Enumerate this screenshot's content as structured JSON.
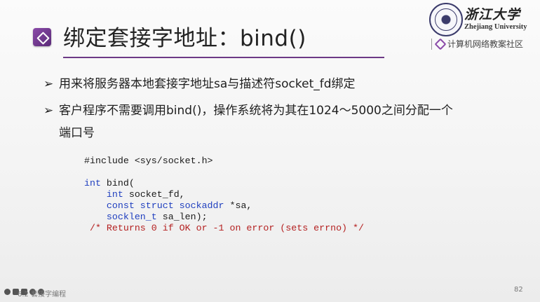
{
  "slide": {
    "title": "绑定套接字地址：bind()",
    "logo": {
      "university_cn": "浙江大学",
      "university_en": "Zhejiang University",
      "community": "计算机网络教案社区"
    },
    "bullets": [
      "用来将服务器本地套接字地址sa与描述符socket_fd绑定",
      "客户程序不需要调用bind()，操作系统将为其在1024～5000之间分配一个"
    ],
    "bullet2_continuation": "端口号",
    "code": {
      "line1": "#include <sys/socket.h>",
      "line3_type": "int",
      "line3_rest": " bind(",
      "line4_kw": "int",
      "line4_rest": " socket_fd,",
      "line5_kw": "const struct sockaddr",
      "line5_rest": " *sa,",
      "line6_kw": "socklen_t",
      "line6_rest": " sa_len);",
      "line7": "/* Returns 0 if OK or -1 on error (sets errno) */"
    },
    "footer_text": "6.2 套接字编程",
    "page_number": "82"
  },
  "colors": {
    "accent": "#6d3a86",
    "keyword": "#1f3fbf",
    "comment": "#b41f1f"
  }
}
